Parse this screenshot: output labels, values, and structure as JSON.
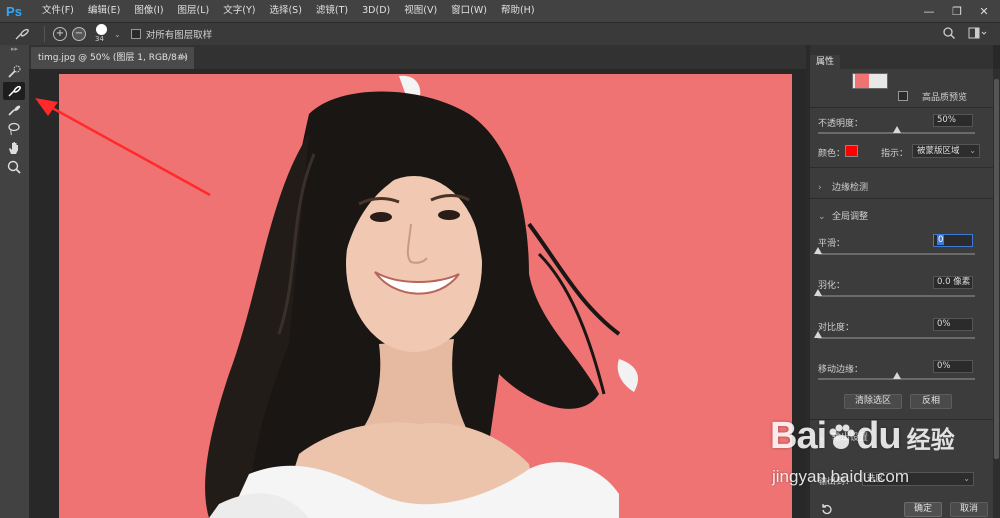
{
  "app": {
    "logo": "Ps"
  },
  "menu": [
    "文件(F)",
    "编辑(E)",
    "图像(I)",
    "图层(L)",
    "文字(Y)",
    "选择(S)",
    "滤镜(T)",
    "3D(D)",
    "视图(V)",
    "窗口(W)",
    "帮助(H)"
  ],
  "window_controls": {
    "minimize": "—",
    "restore": "❐",
    "close": "✕"
  },
  "options_bar": {
    "add_mode": "+",
    "subtract_mode": "−",
    "brush_size": "34",
    "sample_all_layers_label": "对所有图层取样"
  },
  "document_tab": {
    "title": "timg.jpg @ 50% (图层 1, RGB/8#) *",
    "close": "×"
  },
  "panel": {
    "tab_title": "属性",
    "hq_preview_label": "高品质预览",
    "opacity_label": "不透明度：",
    "opacity_value": "50%",
    "opacity_level": 0.5,
    "color_label": "颜色：",
    "overlay_color": "#ff0000",
    "indicates_label": "指示：",
    "indicates_value": "被蒙版区域",
    "edge_detection_label": "边缘检测",
    "global_refine_label": "全局调整",
    "smooth_label": "平滑：",
    "smooth_value": "0",
    "smooth_level": 0,
    "feather_label": "羽化：",
    "feather_value": "0.0 像素",
    "feather_level": 0,
    "contrast_label": "对比度：",
    "contrast_value": "0%",
    "contrast_level": 0,
    "shift_edge_label": "移动边缘：",
    "shift_edge_value": "0%",
    "shift_edge_level": 0.5,
    "clear_selection_label": "清除选区",
    "invert_label": "反相",
    "output_settings_label": "输出设置",
    "output_to_label": "输出到：",
    "output_to_value": "选区",
    "ok_label": "确定",
    "cancel_label": "取消"
  },
  "canvas": {
    "background_color": "#f07374"
  },
  "watermark": {
    "logo": "Bai",
    "logo2": "du",
    "sub": "经验",
    "url": "jingyan.baidu.com"
  }
}
